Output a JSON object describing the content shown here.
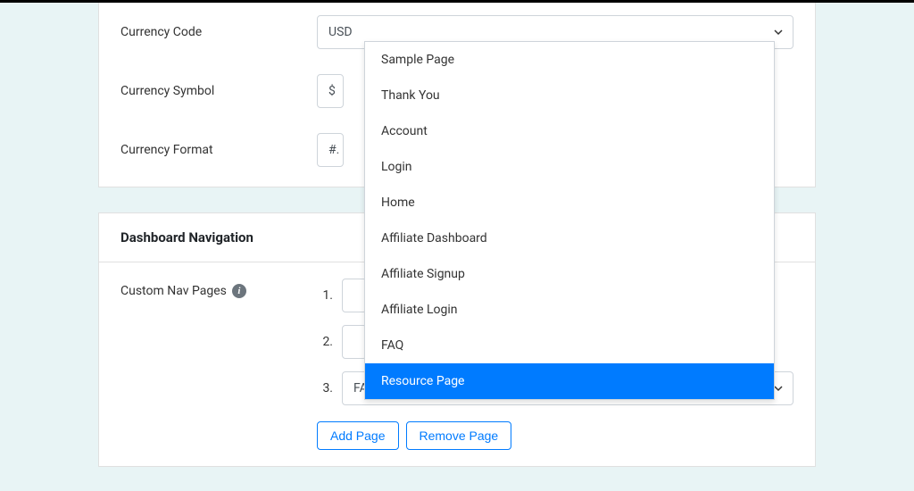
{
  "currencyPanel": {
    "rows": [
      {
        "label": "Currency Code",
        "value": "USD"
      },
      {
        "label": "Currency Symbol",
        "value": "$"
      },
      {
        "label": "Currency Format",
        "value": "#."
      }
    ]
  },
  "dashboardPanel": {
    "title": "Dashboard Navigation",
    "navLabel": "Custom Nav Pages",
    "pages": [
      {
        "num": "1.",
        "value": ""
      },
      {
        "num": "2.",
        "value": ""
      },
      {
        "num": "3.",
        "value": "FAQ"
      }
    ],
    "buttons": {
      "add": "Add Page",
      "remove": "Remove Page"
    }
  },
  "dropdown": {
    "items": [
      {
        "label": "Sample Page",
        "highlighted": false
      },
      {
        "label": "Thank You",
        "highlighted": false
      },
      {
        "label": "Account",
        "highlighted": false
      },
      {
        "label": "Login",
        "highlighted": false
      },
      {
        "label": "Home",
        "highlighted": false
      },
      {
        "label": "Affiliate Dashboard",
        "highlighted": false
      },
      {
        "label": "Affiliate Signup",
        "highlighted": false
      },
      {
        "label": "Affiliate Login",
        "highlighted": false
      },
      {
        "label": "FAQ",
        "highlighted": false
      },
      {
        "label": "Resource Page",
        "highlighted": true
      }
    ]
  }
}
